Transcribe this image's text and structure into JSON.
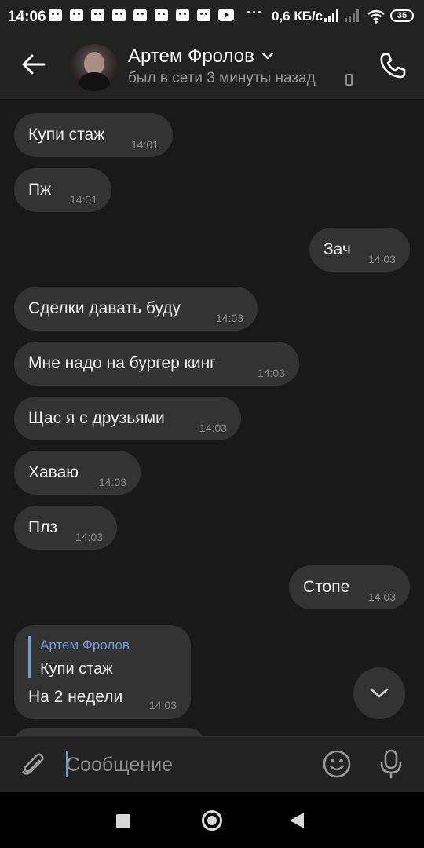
{
  "status_bar": {
    "time": "14:06",
    "dots": "···",
    "network_speed": "0,6 КБ/с",
    "battery": "35",
    "notification_icons": [
      "discord-icon",
      "discord-icon",
      "discord-icon",
      "discord-icon",
      "discord-icon",
      "discord-icon",
      "discord-icon",
      "discord-icon",
      "youtube-icon"
    ]
  },
  "header": {
    "contact_name": "Артем Фролов",
    "last_seen": "был в сети 3 минуты назад"
  },
  "messages": [
    {
      "text": "Купи стаж",
      "time": "14:01",
      "outgoing": false
    },
    {
      "text": "Пж",
      "time": "14:01",
      "outgoing": false
    },
    {
      "text": "Зач",
      "time": "14:03",
      "outgoing": true
    },
    {
      "text": "Сделки давать буду",
      "time": "14:03",
      "outgoing": false
    },
    {
      "text": "Мне надо на бургер кинг",
      "time": "14:03",
      "outgoing": false
    },
    {
      "text": "Щас я с друзьями",
      "time": "14:03",
      "outgoing": false
    },
    {
      "text": "Хаваю",
      "time": "14:03",
      "outgoing": false
    },
    {
      "text": "Плз",
      "time": "14:03",
      "outgoing": false
    },
    {
      "text": "Стопе",
      "time": "14:03",
      "outgoing": true
    },
    {
      "text": "На 2 недели",
      "time": "14:03",
      "outgoing": false,
      "reply_to": {
        "author": "Артем Фролов",
        "text": "Купи стаж"
      }
    }
  ],
  "composer": {
    "placeholder": "Сообщение"
  },
  "colors": {
    "background": "#19191a",
    "bar": "#222223",
    "bubble": "#333334",
    "accent": "#6c9fd9"
  }
}
